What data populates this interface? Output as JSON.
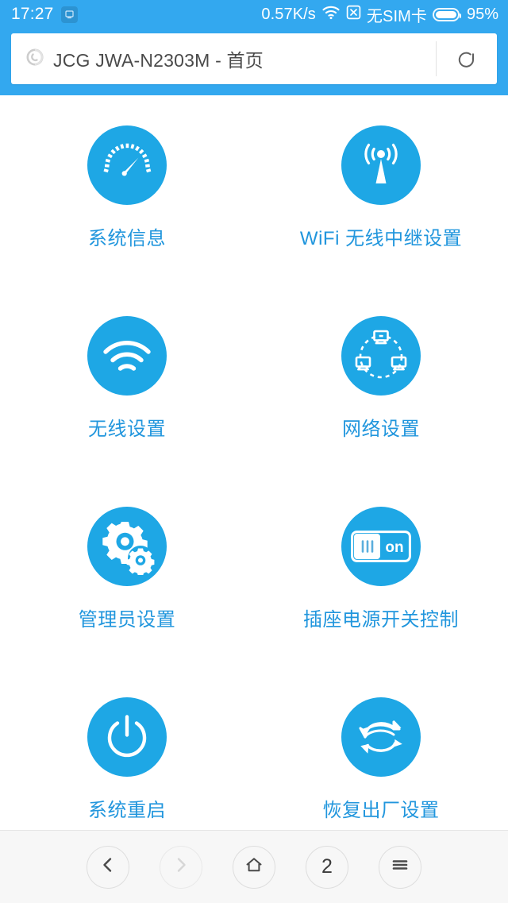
{
  "statusbar": {
    "time": "17:27",
    "app_icon": "notification-app-icon",
    "network_speed": "0.57K/s",
    "wifi_icon": "wifi-icon",
    "signal_off_icon": "signal-off-icon",
    "sim_status": "无SIM卡",
    "battery_icon": "battery-icon",
    "battery_percent": "95%"
  },
  "addressbar": {
    "page_icon": "page-loading-icon",
    "url_text": "JCG JWA-N2303M - 首页",
    "reload_icon": "reload-icon"
  },
  "tiles": [
    {
      "label": "系统信息",
      "icon": "gauge-icon"
    },
    {
      "label": "WiFi 无线中继设置",
      "icon": "broadcast-tower-icon"
    },
    {
      "label": "无线设置",
      "icon": "wifi-signal-icon"
    },
    {
      "label": "网络设置",
      "icon": "network-topology-icon"
    },
    {
      "label": "管理员设置",
      "icon": "gears-icon"
    },
    {
      "label": "插座电源开关控制",
      "icon": "toggle-switch-icon"
    },
    {
      "label": "系统重启",
      "icon": "power-icon"
    },
    {
      "label": "恢复出厂设置",
      "icon": "restore-arrows-icon"
    }
  ],
  "toggle_icon_text": "on",
  "bottomnav": {
    "back_icon": "chevron-left-icon",
    "forward_icon": "chevron-right-icon",
    "home_icon": "home-icon",
    "tab_count": "2",
    "menu_icon": "hamburger-menu-icon"
  },
  "colors": {
    "brand_blue": "#33a8ef",
    "icon_blue": "#1ea7e5",
    "label_blue": "#2196dd",
    "page_bg": "#ffffff",
    "nav_bg": "#f7f7f7"
  }
}
